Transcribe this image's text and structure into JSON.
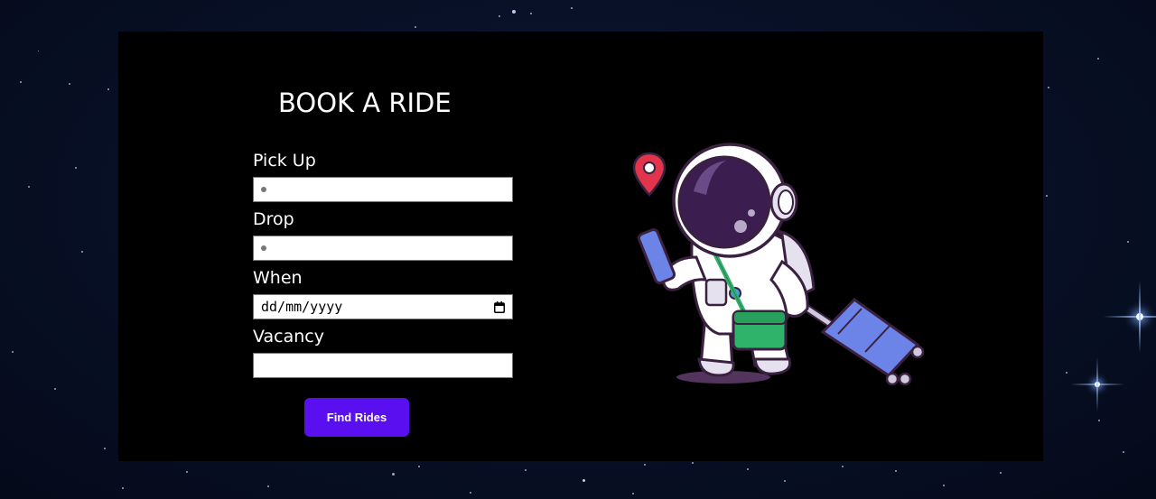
{
  "title": "BOOK A RIDE",
  "form": {
    "pickup": {
      "label": "Pick Up",
      "value": ""
    },
    "drop": {
      "label": "Drop",
      "value": ""
    },
    "when": {
      "label": "When",
      "placeholder": "dd/mm/yyyy"
    },
    "vacancy": {
      "label": "Vacancy",
      "value": ""
    }
  },
  "button": {
    "label": "Find Rides"
  },
  "colors": {
    "background": "#081128",
    "panel": "#000000",
    "button": "#5a0ff0",
    "text": "#ffffff"
  },
  "icons": {
    "calendar": "calendar-icon",
    "location_pin": "location-pin-icon",
    "illustration": "astronaut-with-suitcase"
  }
}
